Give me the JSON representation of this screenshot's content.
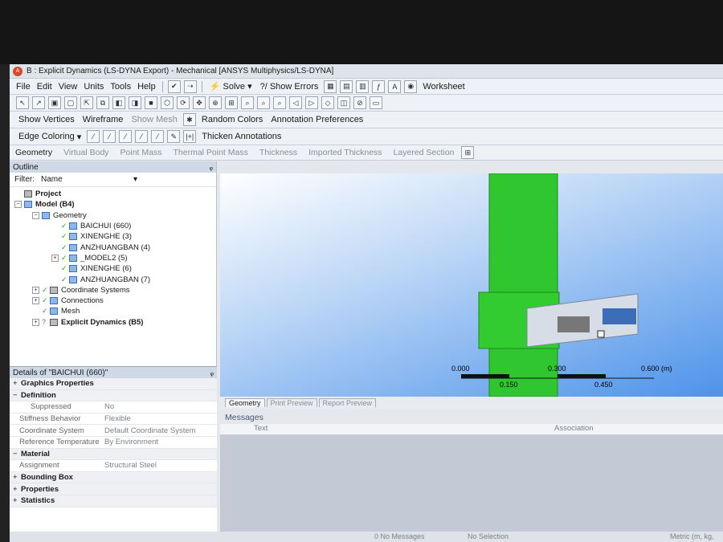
{
  "window": {
    "title": "B : Explicit Dynamics (LS-DYNA Export) - Mechanical [ANSYS Multiphysics/LS-DYNA]"
  },
  "menu": [
    "File",
    "Edit",
    "View",
    "Units",
    "Tools",
    "Help"
  ],
  "toolbar1": {
    "solve": "Solve",
    "show_errors": "?/ Show Errors",
    "worksheet": "Worksheet"
  },
  "toolbar2": {
    "show_vertices": "Show Vertices",
    "wireframe": "Wireframe",
    "show_mesh": "Show Mesh",
    "random_colors": "Random Colors",
    "annotation_prefs": "Annotation Preferences"
  },
  "toolbar3": {
    "edge_coloring": "Edge Coloring",
    "thicken_annotations": "Thicken Annotations"
  },
  "context_tabs": [
    "Geometry",
    "Virtual Body",
    "Point Mass",
    "Thermal Point Mass",
    "Thickness",
    "Imported Thickness",
    "Layered Section"
  ],
  "outline": {
    "title": "Outline",
    "filter_label": "Filter:",
    "filter_value": "Name",
    "tree": [
      {
        "label": "Project",
        "level": 0,
        "bold": true
      },
      {
        "label": "Model (B4)",
        "level": 1,
        "bold": true
      },
      {
        "label": "Geometry",
        "level": 2
      },
      {
        "label": "BAICHUI (660)",
        "level": 3
      },
      {
        "label": "XINENGHE (3)",
        "level": 3
      },
      {
        "label": "ANZHUANGBAN (4)",
        "level": 3
      },
      {
        "label": "_MODEL2 (5)",
        "level": 3
      },
      {
        "label": "XINENGHE (6)",
        "level": 3
      },
      {
        "label": "ANZHUANGBAN (7)",
        "level": 3
      },
      {
        "label": "Coordinate Systems",
        "level": 2
      },
      {
        "label": "Connections",
        "level": 2
      },
      {
        "label": "Mesh",
        "level": 2
      },
      {
        "label": "Explicit Dynamics (B5)",
        "level": 2,
        "bold": true
      }
    ]
  },
  "details": {
    "title": "Details of \"BAICHUI (660)\"",
    "groups": {
      "graphics": "Graphics Properties",
      "definition": "Definition",
      "material": "Material",
      "bounding": "Bounding Box",
      "properties": "Properties",
      "statistics": "Statistics"
    },
    "rows": {
      "suppressed_k": "Suppressed",
      "suppressed_v": "No",
      "stiffness_k": "Stiffness Behavior",
      "stiffness_v": "Flexible",
      "coord_k": "Coordinate System",
      "coord_v": "Default Coordinate System",
      "reftemp_k": "Reference Temperature",
      "reftemp_v": "By Environment",
      "assign_k": "Assignment",
      "assign_v": "Structural Steel"
    }
  },
  "scale": {
    "t0": "0.000",
    "t1": "0.150",
    "t2": "0.300",
    "t3": "0.450",
    "t4": "0.600 (m)"
  },
  "view_tabs": [
    "Geometry",
    "Print Preview",
    "Report Preview"
  ],
  "messages": {
    "title": "Messages",
    "col_text": "Text",
    "col_assoc": "Association"
  },
  "status": {
    "messages": "0 No Messages",
    "selection": "No Selection",
    "units": "Metric (m, kg,"
  },
  "colors": {
    "body_green": "#2fc630",
    "viewport_top": "#ffffff",
    "viewport_bottom": "#4d93ea"
  }
}
